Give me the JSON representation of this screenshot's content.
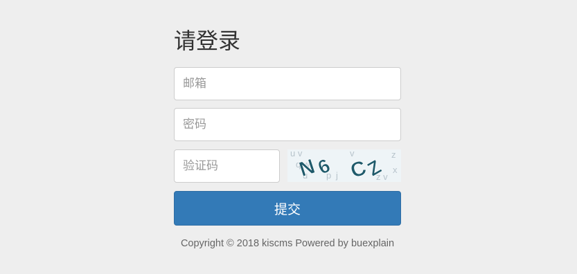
{
  "page": {
    "title": "请登录"
  },
  "form": {
    "email_placeholder": "邮箱",
    "password_placeholder": "密码",
    "captcha_placeholder": "验证码",
    "submit_label": "提交"
  },
  "captcha": {
    "main_text": "N6 CZ",
    "noise_text": "u p j z v x q w"
  },
  "footer": {
    "copyright": "Copyright © 2018 kiscms Powered by buexplain"
  },
  "colors": {
    "background": "#eeeeee",
    "primary": "#337ab7",
    "captcha_ink": "#1f5a6b"
  }
}
